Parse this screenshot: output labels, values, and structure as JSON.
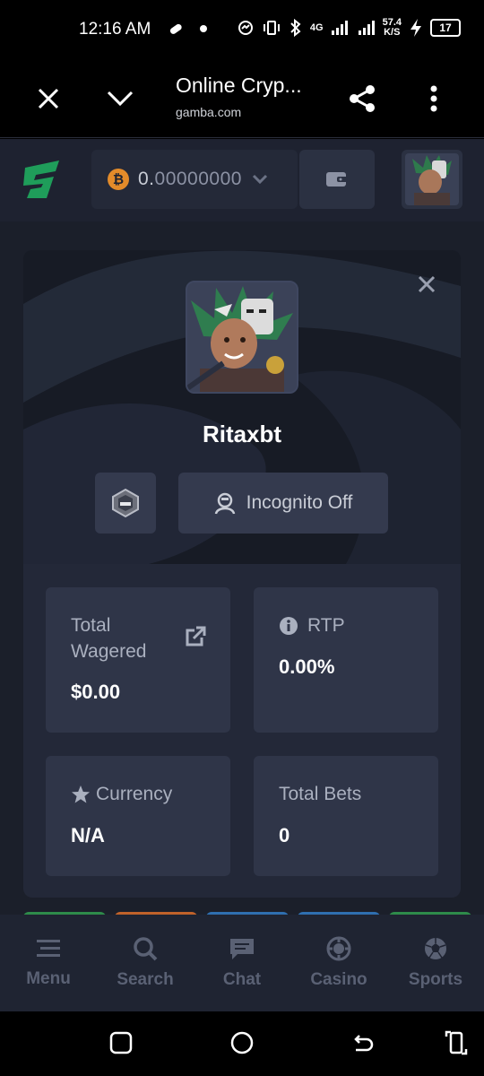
{
  "status_bar": {
    "time": "12:16 AM",
    "net_type": "4G",
    "speed_value": "57.4",
    "speed_unit": "K/S",
    "battery": "17"
  },
  "browser": {
    "title": "Online Cryp...",
    "url": "gamba.com",
    "icons": [
      "close-icon",
      "chevron-down-icon",
      "share-icon",
      "more-vert-icon"
    ]
  },
  "header": {
    "balance_currency_icon": "bitcoin-icon",
    "balance_prefix": "0.",
    "balance_rest": "00000000",
    "wallet_icon": "wallet-icon"
  },
  "profile": {
    "username": "Ritaxbt",
    "incognito_label": "Incognito Off",
    "stats": {
      "total_wagered_label": "Total Wagered",
      "total_wagered_value": "$0.00",
      "rtp_label": "RTP",
      "rtp_value": "0.00%",
      "currency_label": "Currency",
      "currency_value": "N/A",
      "total_bets_label": "Total Bets",
      "total_bets_value": "0"
    }
  },
  "chip_colors": [
    "#2e8b4a",
    "#c0622a",
    "#2f6fb0",
    "#2f6fb0",
    "#2e8b4a"
  ],
  "bottom_nav": {
    "items": [
      {
        "label": "Menu",
        "icon": "menu-icon"
      },
      {
        "label": "Search",
        "icon": "search-icon"
      },
      {
        "label": "Chat",
        "icon": "chat-icon"
      },
      {
        "label": "Casino",
        "icon": "casino-chip-icon"
      },
      {
        "label": "Sports",
        "icon": "soccer-ball-icon"
      }
    ]
  },
  "colors": {
    "accent_green": "#1f9d5a",
    "bitcoin_orange": "#e38b2a",
    "panel": "#232838",
    "card": "#2f3548"
  }
}
